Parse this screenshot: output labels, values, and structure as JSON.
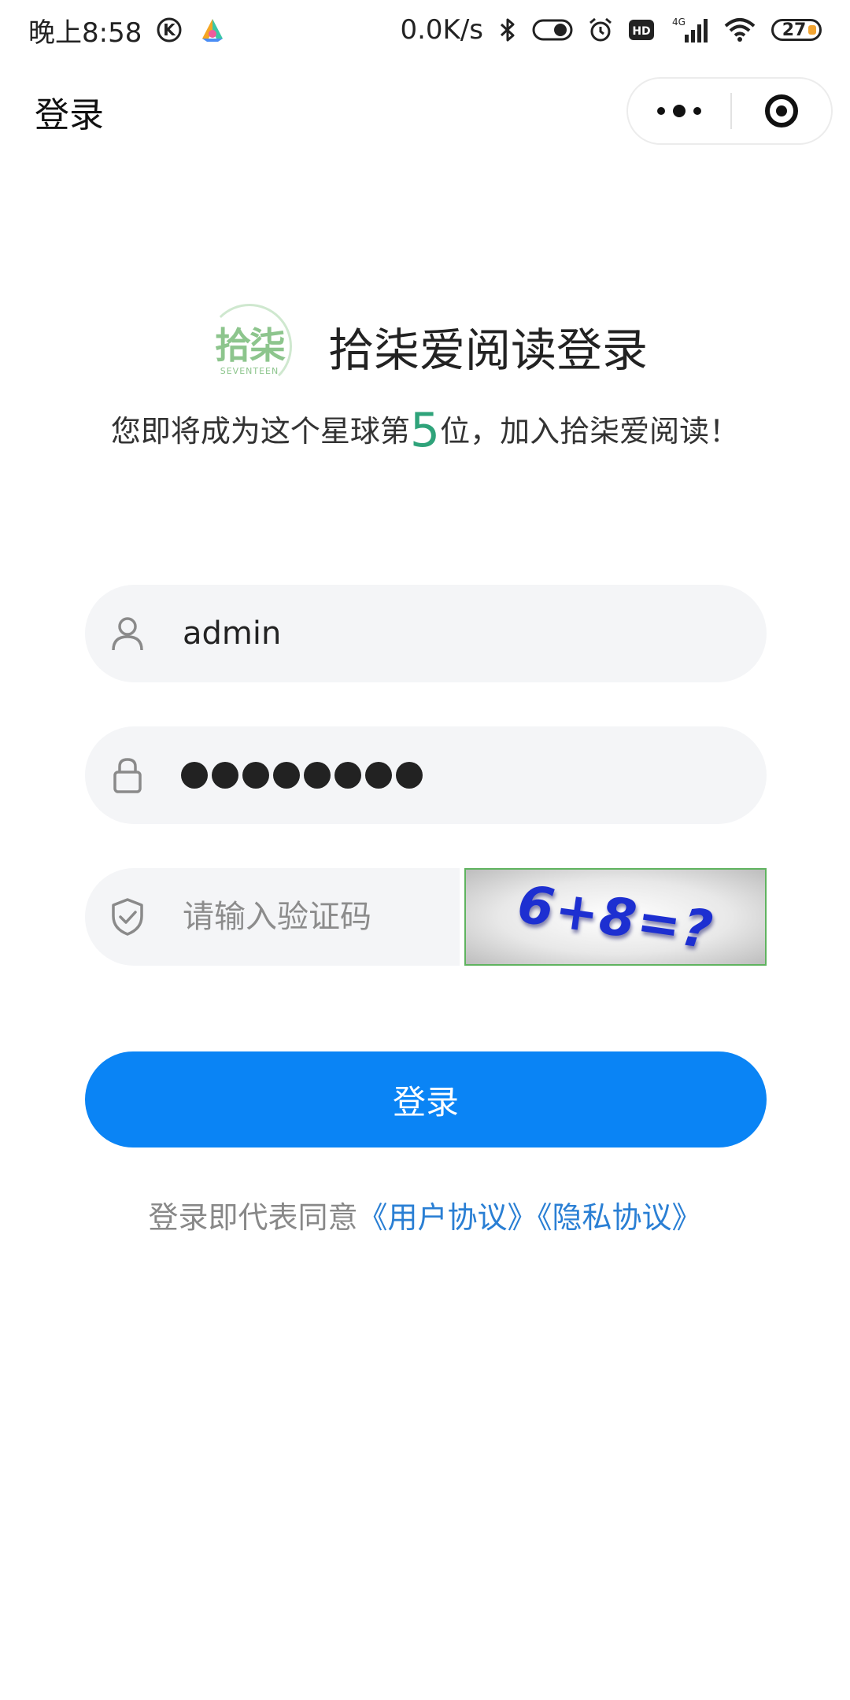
{
  "status_bar": {
    "time": "晚上8:58",
    "network_speed": "0.0K/s",
    "signal_label": "4G",
    "hd_label": "HD",
    "battery": "27",
    "icons": [
      "k-circle-icon",
      "app-logo-icon",
      "bluetooth-icon",
      "toggle-icon",
      "alarm-icon",
      "hd-icon",
      "signal-icon",
      "wifi-icon",
      "battery-icon"
    ]
  },
  "nav": {
    "title": "登录"
  },
  "header": {
    "logo_mark": "拾柒",
    "logo_sub": "SEVENTEEN",
    "title": "拾柒爱阅读登录",
    "tagline_prefix": "您即将成为这个星球第",
    "tagline_number": "5",
    "tagline_suffix": "位，加入拾柒爱阅读！"
  },
  "form": {
    "username_value": "admin",
    "password_length": 8,
    "captcha_placeholder": "请输入验证码",
    "captcha_text": "6+8=?"
  },
  "login_button": {
    "label": "登录"
  },
  "agreement": {
    "prefix": "登录即代表同意",
    "user_agreement": "《用户协议》",
    "privacy_policy": "《隐私协议》"
  },
  "colors": {
    "primary": "#0a84f5",
    "accent_green": "#2fa37a",
    "link": "#2a7fd4",
    "field_bg": "#f4f5f7"
  }
}
